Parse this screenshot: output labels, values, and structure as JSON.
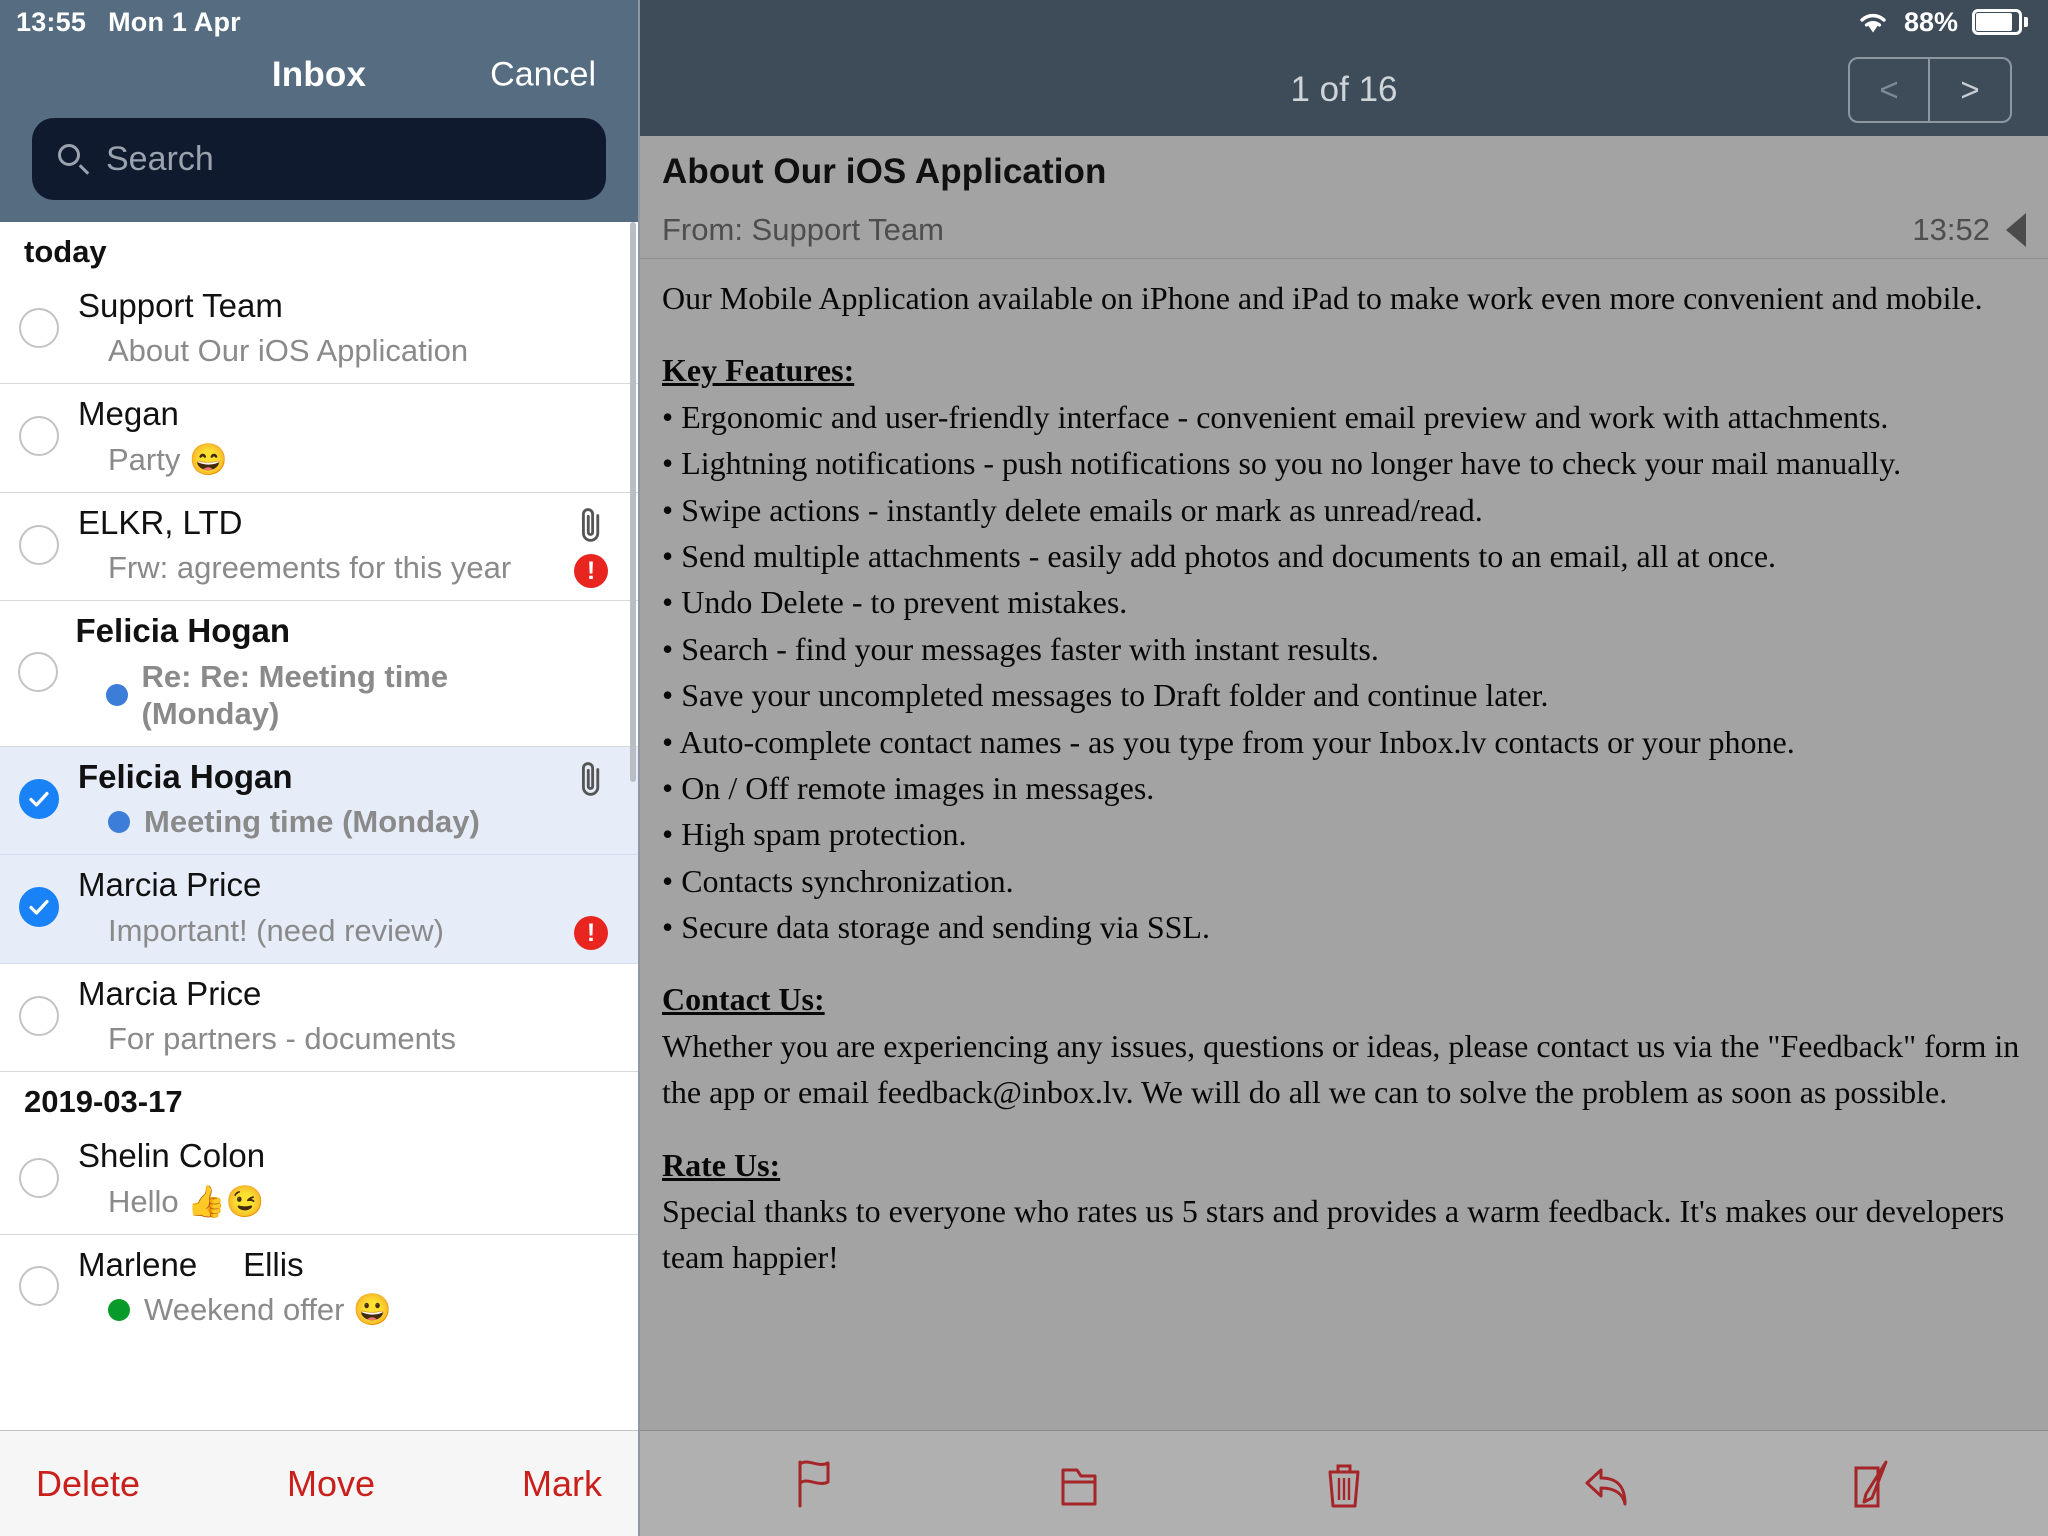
{
  "status_bar": {
    "time": "13:55",
    "date": "Mon 1 Apr",
    "battery_percent": "88%",
    "wifi_icon": "wifi-icon",
    "battery_icon": "battery-icon"
  },
  "sidebar": {
    "title": "Inbox",
    "cancel_label": "Cancel",
    "search": {
      "placeholder": "Search",
      "value": "",
      "icon": "search-icon"
    },
    "groups": [
      {
        "label": "today",
        "items": [
          {
            "sender": "Support Team",
            "subject": "About Our iOS Application",
            "selected": false,
            "sender_bold": false,
            "subject_bold": false,
            "unread_dot": "",
            "attachment": false,
            "important": false
          },
          {
            "sender": "Megan",
            "subject": "Party 😄",
            "selected": false,
            "sender_bold": false,
            "subject_bold": false,
            "unread_dot": "",
            "attachment": false,
            "important": false
          },
          {
            "sender": "ELKR, LTD",
            "subject": "Frw: agreements for this year",
            "selected": false,
            "sender_bold": false,
            "subject_bold": false,
            "unread_dot": "",
            "attachment": true,
            "important": true
          },
          {
            "sender": "Felicia Hogan",
            "subject": "Re: Re: Meeting time (Monday)",
            "selected": false,
            "sender_bold": true,
            "subject_bold": true,
            "unread_dot": "#3b7dd8",
            "attachment": false,
            "important": false
          },
          {
            "sender": "Felicia Hogan",
            "subject": "Meeting time (Monday)",
            "selected": true,
            "sender_bold": true,
            "subject_bold": true,
            "unread_dot": "#3b7dd8",
            "attachment": true,
            "important": false
          },
          {
            "sender": "Marcia Price",
            "subject": "Important! (need review)",
            "selected": true,
            "sender_bold": false,
            "subject_bold": false,
            "unread_dot": "",
            "attachment": false,
            "important": true
          },
          {
            "sender": "Marcia Price",
            "subject": "For partners - documents",
            "selected": false,
            "sender_bold": false,
            "subject_bold": false,
            "unread_dot": "",
            "attachment": false,
            "important": false
          }
        ]
      },
      {
        "label": "2019-03-17",
        "items": [
          {
            "sender": "Shelin Colon",
            "subject": "Hello 👍😉",
            "selected": false,
            "sender_bold": false,
            "subject_bold": false,
            "unread_dot": "",
            "attachment": false,
            "important": false
          },
          {
            "sender": "Marlene     Ellis",
            "subject": "Weekend offer 😀",
            "selected": false,
            "sender_bold": false,
            "subject_bold": false,
            "unread_dot": "#089b2a",
            "attachment": false,
            "important": false
          }
        ]
      }
    ],
    "toolbar": {
      "delete_label": "Delete",
      "move_label": "Move",
      "mark_label": "Mark",
      "accent_color": "#c9201c"
    }
  },
  "reader": {
    "page_indicator": "1 of 16",
    "prev_label": "<",
    "next_label": ">",
    "subject": "About Our iOS Application",
    "from": "From: Support Team",
    "time": "13:52",
    "detail_toggle_icon": "triangle-left-icon",
    "body": {
      "intro": "Our Mobile Application available on iPhone and iPad to make work even more convenient and mobile.",
      "key_features_heading": "Key Features:",
      "features": [
        "• Ergonomic and user-friendly interface - convenient email preview and work with attachments.",
        "• Lightning notifications - push notifications so you no longer have to check your mail manually.",
        "• Swipe actions - instantly delete emails or mark as unread/read.",
        "• Send multiple attachments - easily add photos and documents to an email, all at once.",
        "• Undo Delete - to prevent mistakes.",
        "• Search - find your messages faster with instant results.",
        "• Save your uncompleted messages to Draft folder and continue later.",
        "• Auto-complete contact names - as you type from your Inbox.lv contacts or your phone.",
        "• On / Off remote images in messages.",
        "• High spam protection.",
        "• Contacts synchronization.",
        "• Secure data storage and sending via SSL."
      ],
      "contact_heading": "Contact Us: ",
      "contact_text": "Whether you are experiencing any issues, questions or ideas, please contact us via the \"Feedback\" form in the app or email feedback@inbox.lv. We will do all we can to solve the problem as soon as possible.",
      "rate_heading": "Rate Us:",
      "rate_text": "Special thanks to everyone who rates us 5 stars and provides a warm feedback. It's makes our developers team happier!"
    },
    "toolbar_icons": [
      "flag-icon",
      "folder-icon",
      "trash-icon",
      "reply-icon",
      "compose-icon"
    ],
    "toolbar_icon_color": "#a52528"
  }
}
